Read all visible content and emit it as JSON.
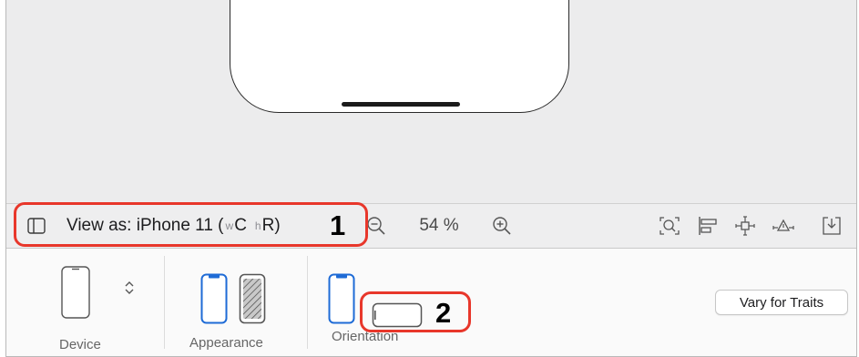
{
  "toolbar": {
    "view_as_prefix": "View as: iPhone 11 (",
    "view_as_w_prefix": "w",
    "view_as_w_value": "C",
    "view_as_h_prefix": "h",
    "view_as_h_value": "R",
    "view_as_suffix": ")",
    "zoom_level": "54 %",
    "icons": [
      "sidebar-toggle-icon",
      "zoom-out-icon",
      "zoom-in-icon",
      "zoom-to-fit-icon",
      "align-icon",
      "add-constraints-icon",
      "resolve-autolayout-issues-icon",
      "embed-in-icon"
    ]
  },
  "panel": {
    "device_label": "Device",
    "appearance_label": "Appearance",
    "orientation_label": "Orientation",
    "vary_for_traits_label": "Vary for Traits"
  },
  "callouts": [
    {
      "number": "1"
    },
    {
      "number": "2"
    }
  ],
  "colors": {
    "callout": "#e8372b",
    "device_blue": "#1e6bd6",
    "canvas": "#ececed"
  }
}
